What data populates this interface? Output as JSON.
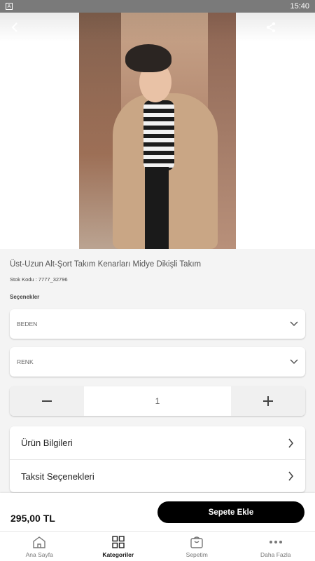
{
  "status_bar": {
    "app_badge": "A",
    "time": "15:40"
  },
  "header": {
    "back_icon": "chevron-left-icon",
    "share_icon": "share-icon"
  },
  "product": {
    "title": "Üst-Uzun Alt-Şort Takım Kenarları Midye Dikişli Takım",
    "sku": "Stok Kodu : 7777_32796",
    "options_label": "Seçenekler",
    "size_select": {
      "label": "BEDEN"
    },
    "color_select": {
      "label": "RENK"
    },
    "quantity": 1
  },
  "info_sections": [
    {
      "label": "Ürün Bilgileri"
    },
    {
      "label": "Taksit Seçenekleri"
    }
  ],
  "purchase": {
    "price": "295,00 TL",
    "add_to_cart_label": "Sepete Ekle"
  },
  "tabbar": {
    "items": [
      {
        "label": "Ana Sayfa",
        "icon": "home-icon",
        "active": false
      },
      {
        "label": "Kategoriler",
        "icon": "grid-icon",
        "active": true
      },
      {
        "label": "Sepetim",
        "icon": "basket-icon",
        "active": false
      },
      {
        "label": "Daha Fazla",
        "icon": "more-icon",
        "active": false
      }
    ]
  },
  "colors": {
    "accent": "#000000",
    "background": "#f4f4f4",
    "status_bar": "#7a7a7a"
  }
}
